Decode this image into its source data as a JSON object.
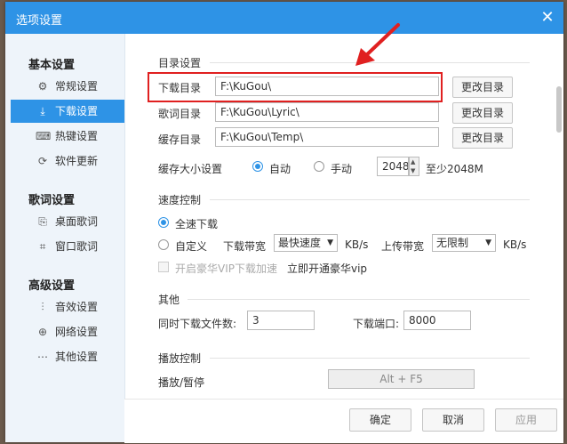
{
  "window": {
    "title": "选项设置",
    "close_icon": "close-icon"
  },
  "sidebar": {
    "sections": [
      {
        "title": "基本设置",
        "items": [
          {
            "icon": "gear-icon",
            "glyph": "⚙",
            "label": "常规设置"
          },
          {
            "icon": "download-icon",
            "glyph": "⤓",
            "label": "下载设置",
            "active": true
          },
          {
            "icon": "keyboard-icon",
            "glyph": "⌨",
            "label": "热键设置"
          },
          {
            "icon": "refresh-icon",
            "glyph": "⟳",
            "label": "软件更新"
          }
        ]
      },
      {
        "title": "歌词设置",
        "items": [
          {
            "icon": "desktop-lyric-icon",
            "glyph": "⎘",
            "label": "桌面歌词"
          },
          {
            "icon": "window-lyric-icon",
            "glyph": "⌗",
            "label": "窗口歌词"
          }
        ]
      },
      {
        "title": "高级设置",
        "items": [
          {
            "icon": "equalizer-icon",
            "glyph": "⫶",
            "label": "音效设置"
          },
          {
            "icon": "globe-icon",
            "glyph": "⊕",
            "label": "网络设置"
          },
          {
            "icon": "more-icon",
            "glyph": "⋯",
            "label": "其他设置"
          }
        ]
      }
    ]
  },
  "dir": {
    "title": "目录设置",
    "download_label": "下载目录",
    "download_value": "F:\\KuGou\\",
    "lyric_label": "歌词目录",
    "lyric_value": "F:\\KuGou\\Lyric\\",
    "cache_label": "缓存目录",
    "cache_value": "F:\\KuGou\\Temp\\",
    "change_btn": "更改目录",
    "cache_size_label": "缓存大小设置",
    "auto_label": "自动",
    "manual_label": "手动",
    "size_value": "2048",
    "min_note": "至少2048M"
  },
  "speed": {
    "title": "速度控制",
    "full_label": "全速下载",
    "custom_label": "自定义",
    "down_bw_label": "下载带宽",
    "down_bw_value": "最快速度",
    "unit1": "KB/s",
    "up_bw_label": "上传带宽",
    "up_bw_value": "无限制",
    "unit2": "KB/s",
    "vip_label": "开启豪华VIP下载加速",
    "vip_link": "立即开通豪华vip"
  },
  "other": {
    "title": "其他",
    "concurrent_label": "同时下载文件数:",
    "concurrent_value": "3",
    "port_label": "下载端口:",
    "port_value": "8000"
  },
  "playback": {
    "title": "播放控制",
    "pause_label": "播放/暂停",
    "pause_hotkey": "Alt + F5"
  },
  "footer": {
    "ok": "确定",
    "cancel": "取消",
    "apply": "应用"
  },
  "colors": {
    "accent": "#2e93e6",
    "highlight": "#e02020"
  }
}
